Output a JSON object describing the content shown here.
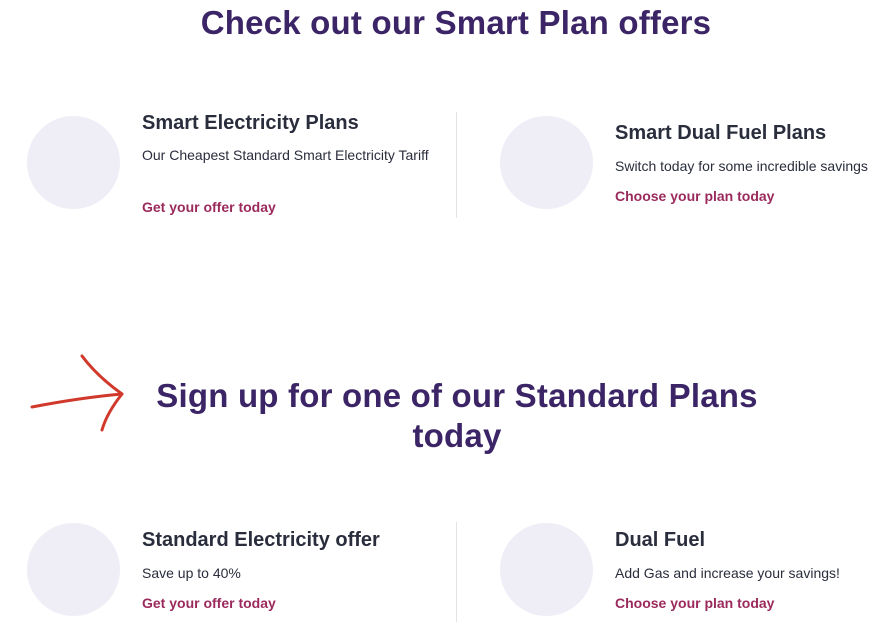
{
  "smart_section": {
    "title": "Check out our Smart Plan offers",
    "cards": [
      {
        "title": "Smart Electricity Plans",
        "description": "Our Cheapest Standard Smart Electricity Tariff",
        "link": "Get your offer today"
      },
      {
        "title": "Smart Dual Fuel Plans",
        "description": "Switch today for some incredible savings",
        "link": "Choose your plan today"
      }
    ]
  },
  "standard_section": {
    "title_line1": "Sign up for one of our Standard Plans",
    "title_line2": "today",
    "cards": [
      {
        "title": "Standard Electricity offer",
        "description": "Save up to 40%",
        "link": "Get your offer today"
      },
      {
        "title": "Dual Fuel",
        "description": "Add Gas and increase your savings!",
        "link": "Choose your plan today"
      }
    ]
  },
  "annotation": {
    "icon": "red-hand-drawn-arrow",
    "color": "#d0392b"
  },
  "colors": {
    "heading": "#3b2566",
    "card_title": "#2a2d3c",
    "link": "#9b2a5c",
    "circle": "#efedf6"
  }
}
